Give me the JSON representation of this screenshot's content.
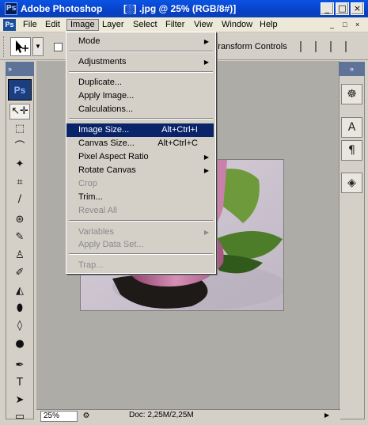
{
  "window": {
    "app_icon": "Ps",
    "app_title": "Adobe Photoshop",
    "doc_title": "[░] .jpg @ 25% (RGB/8#)]",
    "controls": [
      "_",
      "□",
      "×"
    ]
  },
  "menubar": {
    "icon": "Ps",
    "items": [
      "File",
      "Edit",
      "Image",
      "Layer",
      "Select",
      "Filter",
      "View",
      "Window",
      "Help"
    ],
    "active": "Image",
    "window_controls": [
      "_",
      "□",
      "×"
    ]
  },
  "options": {
    "transform_label": "Transform Controls"
  },
  "toolbox": {
    "header": "»",
    "badge": "Ps",
    "tools": [
      {
        "name": "move-tool",
        "glyph": "↖✛"
      },
      {
        "name": "marquee-tool",
        "glyph": "⬚"
      },
      {
        "name": "lasso-tool",
        "glyph": "⌒"
      },
      {
        "name": "magic-wand-tool",
        "glyph": "✦"
      },
      {
        "name": "crop-tool",
        "glyph": "⌗"
      },
      {
        "name": "slice-tool",
        "glyph": "∕"
      },
      {
        "name": "healing-brush-tool",
        "glyph": "⊛"
      },
      {
        "name": "brush-tool",
        "glyph": "✎"
      },
      {
        "name": "clone-stamp-tool",
        "glyph": "♙"
      },
      {
        "name": "history-brush-tool",
        "glyph": "✐"
      },
      {
        "name": "eraser-tool",
        "glyph": "◭"
      },
      {
        "name": "paint-bucket-tool",
        "glyph": "⬮"
      },
      {
        "name": "blur-tool",
        "glyph": "◊"
      },
      {
        "name": "dodge-tool",
        "glyph": "●"
      },
      {
        "name": "pen-tool",
        "glyph": "✒"
      },
      {
        "name": "type-tool",
        "glyph": "T"
      },
      {
        "name": "path-selection-tool",
        "glyph": "➤"
      },
      {
        "name": "shape-tool",
        "glyph": "▭"
      }
    ]
  },
  "right_panel": {
    "header": "»",
    "buttons": [
      {
        "name": "navigator-icon",
        "glyph": "☸"
      },
      {
        "name": "character-icon",
        "glyph": "A"
      },
      {
        "name": "paragraph-icon",
        "glyph": "¶"
      },
      {
        "name": "layers-icon",
        "glyph": "◈"
      }
    ]
  },
  "status": {
    "zoom": "25%",
    "doc_size": "Doc: 2,25M/2,25M",
    "arrow": "▶"
  },
  "image_menu": {
    "groups": [
      [
        {
          "label": "Mode",
          "submenu": true
        }
      ],
      [
        {
          "label": "Adjustments",
          "submenu": true
        }
      ],
      [
        {
          "label": "Duplicate..."
        },
        {
          "label": "Apply Image..."
        },
        {
          "label": "Calculations..."
        }
      ],
      [
        {
          "label": "Image Size...",
          "shortcut": "Alt+Ctrl+I",
          "highlighted": true
        },
        {
          "label": "Canvas Size...",
          "shortcut": "Alt+Ctrl+C"
        },
        {
          "label": "Pixel Aspect Ratio",
          "submenu": true
        },
        {
          "label": "Rotate Canvas",
          "submenu": true
        },
        {
          "label": "Crop",
          "disabled": true
        },
        {
          "label": "Trim..."
        },
        {
          "label": "Reveal All",
          "disabled": true
        }
      ],
      [
        {
          "label": "Variables",
          "submenu": true,
          "disabled": true
        },
        {
          "label": "Apply Data Set...",
          "disabled": true
        }
      ],
      [
        {
          "label": "Trap...",
          "disabled": true
        }
      ]
    ],
    "submenu_arrow": "▶"
  },
  "colors": {
    "highlight": "#0a246a",
    "titlebar": "#0841c9"
  }
}
